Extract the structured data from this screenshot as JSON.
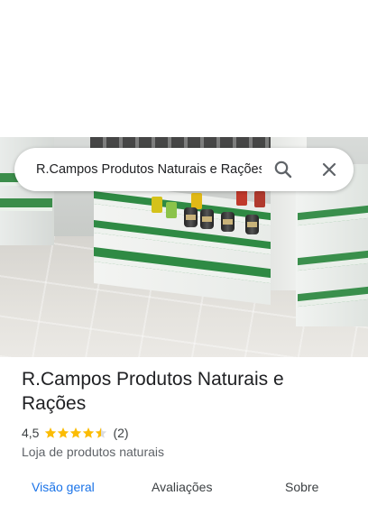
{
  "search": {
    "query": "R.Campos Produtos Naturais e Rações"
  },
  "place": {
    "name": "R.Campos Produtos Naturais e Rações",
    "rating": "4,5",
    "stars": 4.5,
    "review_count": "(2)",
    "category": "Loja de produtos naturais"
  },
  "tabs": [
    {
      "label": "Visão geral",
      "active": true
    },
    {
      "label": "Avaliações",
      "active": false
    },
    {
      "label": "Sobre",
      "active": false
    }
  ],
  "colors": {
    "star": "#fbbc04",
    "active_tab": "#1a73e8",
    "shelf_green": "#2f8a44"
  },
  "icons": {
    "search": "search-icon",
    "close": "close-icon"
  }
}
